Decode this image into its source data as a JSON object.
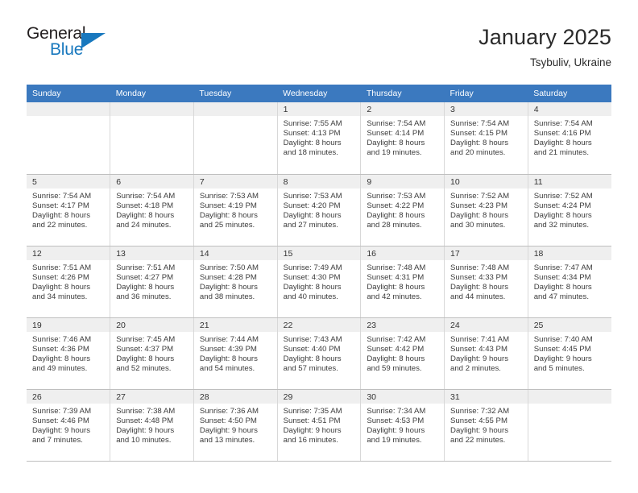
{
  "brand": {
    "name_part1": "General",
    "name_part2": "Blue",
    "logo_icon": "triangle-icon",
    "accent_color": "#1878be"
  },
  "header": {
    "month_title": "January 2025",
    "location": "Tsybuliv, Ukraine"
  },
  "theme": {
    "header_row_bg": "#3b79bf",
    "header_row_text": "#ffffff",
    "daynum_band_bg": "#efefef",
    "grid_border": "#bfbfbf",
    "text_color": "#3c3c3c"
  },
  "calendar": {
    "weekday_headers": [
      "Sunday",
      "Monday",
      "Tuesday",
      "Wednesday",
      "Thursday",
      "Friday",
      "Saturday"
    ],
    "weeks": [
      [
        {
          "day": "",
          "lines": []
        },
        {
          "day": "",
          "lines": []
        },
        {
          "day": "",
          "lines": []
        },
        {
          "day": "1",
          "lines": [
            "Sunrise: 7:55 AM",
            "Sunset: 4:13 PM",
            "Daylight: 8 hours",
            "and 18 minutes."
          ]
        },
        {
          "day": "2",
          "lines": [
            "Sunrise: 7:54 AM",
            "Sunset: 4:14 PM",
            "Daylight: 8 hours",
            "and 19 minutes."
          ]
        },
        {
          "day": "3",
          "lines": [
            "Sunrise: 7:54 AM",
            "Sunset: 4:15 PM",
            "Daylight: 8 hours",
            "and 20 minutes."
          ]
        },
        {
          "day": "4",
          "lines": [
            "Sunrise: 7:54 AM",
            "Sunset: 4:16 PM",
            "Daylight: 8 hours",
            "and 21 minutes."
          ]
        }
      ],
      [
        {
          "day": "5",
          "lines": [
            "Sunrise: 7:54 AM",
            "Sunset: 4:17 PM",
            "Daylight: 8 hours",
            "and 22 minutes."
          ]
        },
        {
          "day": "6",
          "lines": [
            "Sunrise: 7:54 AM",
            "Sunset: 4:18 PM",
            "Daylight: 8 hours",
            "and 24 minutes."
          ]
        },
        {
          "day": "7",
          "lines": [
            "Sunrise: 7:53 AM",
            "Sunset: 4:19 PM",
            "Daylight: 8 hours",
            "and 25 minutes."
          ]
        },
        {
          "day": "8",
          "lines": [
            "Sunrise: 7:53 AM",
            "Sunset: 4:20 PM",
            "Daylight: 8 hours",
            "and 27 minutes."
          ]
        },
        {
          "day": "9",
          "lines": [
            "Sunrise: 7:53 AM",
            "Sunset: 4:22 PM",
            "Daylight: 8 hours",
            "and 28 minutes."
          ]
        },
        {
          "day": "10",
          "lines": [
            "Sunrise: 7:52 AM",
            "Sunset: 4:23 PM",
            "Daylight: 8 hours",
            "and 30 minutes."
          ]
        },
        {
          "day": "11",
          "lines": [
            "Sunrise: 7:52 AM",
            "Sunset: 4:24 PM",
            "Daylight: 8 hours",
            "and 32 minutes."
          ]
        }
      ],
      [
        {
          "day": "12",
          "lines": [
            "Sunrise: 7:51 AM",
            "Sunset: 4:26 PM",
            "Daylight: 8 hours",
            "and 34 minutes."
          ]
        },
        {
          "day": "13",
          "lines": [
            "Sunrise: 7:51 AM",
            "Sunset: 4:27 PM",
            "Daylight: 8 hours",
            "and 36 minutes."
          ]
        },
        {
          "day": "14",
          "lines": [
            "Sunrise: 7:50 AM",
            "Sunset: 4:28 PM",
            "Daylight: 8 hours",
            "and 38 minutes."
          ]
        },
        {
          "day": "15",
          "lines": [
            "Sunrise: 7:49 AM",
            "Sunset: 4:30 PM",
            "Daylight: 8 hours",
            "and 40 minutes."
          ]
        },
        {
          "day": "16",
          "lines": [
            "Sunrise: 7:48 AM",
            "Sunset: 4:31 PM",
            "Daylight: 8 hours",
            "and 42 minutes."
          ]
        },
        {
          "day": "17",
          "lines": [
            "Sunrise: 7:48 AM",
            "Sunset: 4:33 PM",
            "Daylight: 8 hours",
            "and 44 minutes."
          ]
        },
        {
          "day": "18",
          "lines": [
            "Sunrise: 7:47 AM",
            "Sunset: 4:34 PM",
            "Daylight: 8 hours",
            "and 47 minutes."
          ]
        }
      ],
      [
        {
          "day": "19",
          "lines": [
            "Sunrise: 7:46 AM",
            "Sunset: 4:36 PM",
            "Daylight: 8 hours",
            "and 49 minutes."
          ]
        },
        {
          "day": "20",
          "lines": [
            "Sunrise: 7:45 AM",
            "Sunset: 4:37 PM",
            "Daylight: 8 hours",
            "and 52 minutes."
          ]
        },
        {
          "day": "21",
          "lines": [
            "Sunrise: 7:44 AM",
            "Sunset: 4:39 PM",
            "Daylight: 8 hours",
            "and 54 minutes."
          ]
        },
        {
          "day": "22",
          "lines": [
            "Sunrise: 7:43 AM",
            "Sunset: 4:40 PM",
            "Daylight: 8 hours",
            "and 57 minutes."
          ]
        },
        {
          "day": "23",
          "lines": [
            "Sunrise: 7:42 AM",
            "Sunset: 4:42 PM",
            "Daylight: 8 hours",
            "and 59 minutes."
          ]
        },
        {
          "day": "24",
          "lines": [
            "Sunrise: 7:41 AM",
            "Sunset: 4:43 PM",
            "Daylight: 9 hours",
            "and 2 minutes."
          ]
        },
        {
          "day": "25",
          "lines": [
            "Sunrise: 7:40 AM",
            "Sunset: 4:45 PM",
            "Daylight: 9 hours",
            "and 5 minutes."
          ]
        }
      ],
      [
        {
          "day": "26",
          "lines": [
            "Sunrise: 7:39 AM",
            "Sunset: 4:46 PM",
            "Daylight: 9 hours",
            "and 7 minutes."
          ]
        },
        {
          "day": "27",
          "lines": [
            "Sunrise: 7:38 AM",
            "Sunset: 4:48 PM",
            "Daylight: 9 hours",
            "and 10 minutes."
          ]
        },
        {
          "day": "28",
          "lines": [
            "Sunrise: 7:36 AM",
            "Sunset: 4:50 PM",
            "Daylight: 9 hours",
            "and 13 minutes."
          ]
        },
        {
          "day": "29",
          "lines": [
            "Sunrise: 7:35 AM",
            "Sunset: 4:51 PM",
            "Daylight: 9 hours",
            "and 16 minutes."
          ]
        },
        {
          "day": "30",
          "lines": [
            "Sunrise: 7:34 AM",
            "Sunset: 4:53 PM",
            "Daylight: 9 hours",
            "and 19 minutes."
          ]
        },
        {
          "day": "31",
          "lines": [
            "Sunrise: 7:32 AM",
            "Sunset: 4:55 PM",
            "Daylight: 9 hours",
            "and 22 minutes."
          ]
        },
        {
          "day": "",
          "lines": []
        }
      ]
    ]
  }
}
